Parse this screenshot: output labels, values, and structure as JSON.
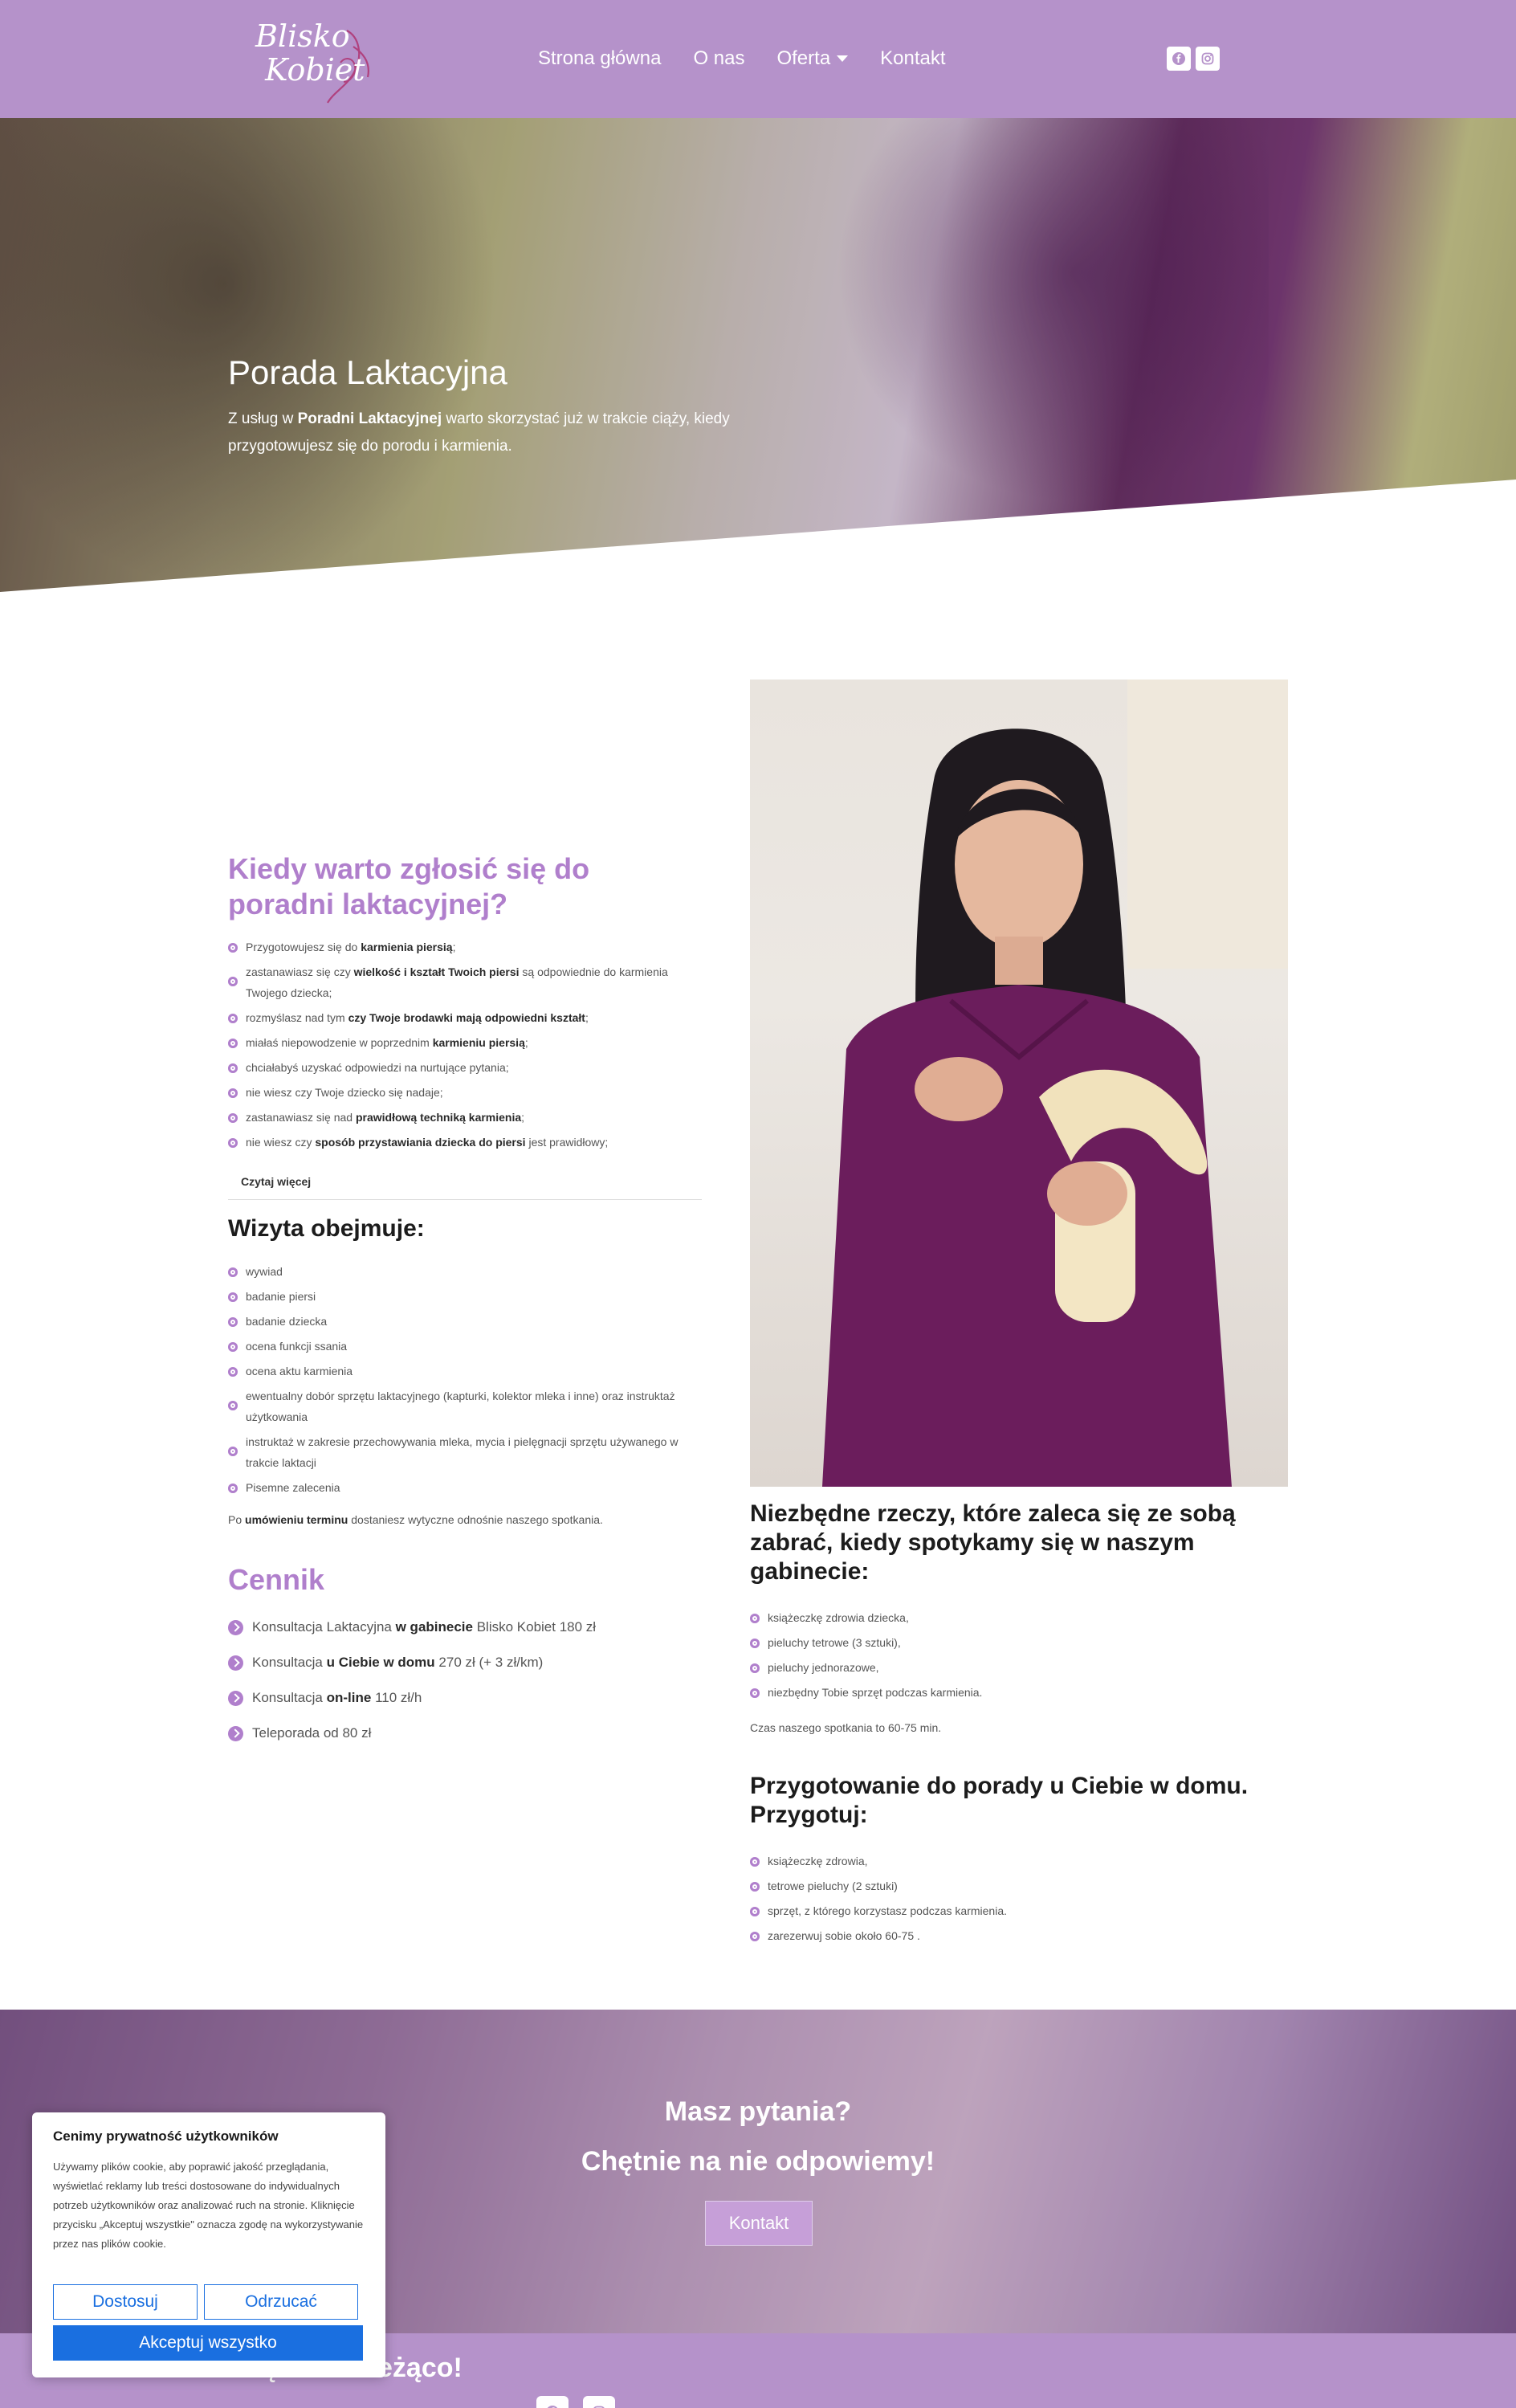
{
  "header": {
    "logo_text": "Blisko\n Kobiet",
    "nav": [
      "Strona główna",
      "O nas",
      "Oferta",
      "Kontakt"
    ]
  },
  "hero": {
    "title": "Porada Laktacyjna",
    "text_before": "Z usług w ",
    "text_bold": "Poradni Laktacyjnej",
    "text_after": " warto skorzystać już w trakcie ciąży, kiedy przygotowujesz się do porodu i karmienia."
  },
  "when": {
    "heading": "Kiedy warto zgłosić się do poradni laktacyjnej?",
    "items": [
      {
        "pre": "Przygotowujesz się do ",
        "bold": "karmienia piersią",
        "post": ";"
      },
      {
        "pre": "zastanawiasz się czy ",
        "bold": "wielkość i kształt Twoich piersi",
        "post": " są odpowiednie do karmienia Twojego dziecka;"
      },
      {
        "pre": "rozmyślasz nad tym ",
        "bold": "czy Twoje brodawki mają odpowiedni kształt",
        "post": ";"
      },
      {
        "pre": "miałaś niepowodzenie w poprzednim ",
        "bold": "karmieniu piersią",
        "post": ";"
      },
      {
        "pre": "chciałabyś uzyskać odpowiedzi na nurtujące pytania;",
        "bold": "",
        "post": ""
      },
      {
        "pre": "nie wiesz czy Twoje dziecko się nadaje;",
        "bold": "",
        "post": ""
      },
      {
        "pre": "zastanawiasz się nad ",
        "bold": "prawidłową techniką karmienia",
        "post": ";"
      },
      {
        "pre": "nie wiesz czy ",
        "bold": "sposób przystawiania dziecka do piersi",
        "post": " jest prawidłowy;"
      }
    ],
    "read_more": "Czytaj więcej"
  },
  "visit": {
    "heading": "Wizyta obejmuje:",
    "items": [
      "wywiad",
      "badanie piersi",
      "badanie dziecka",
      "ocena funkcji ssania",
      "ocena aktu karmienia",
      "ewentualny dobór sprzętu laktacyjnego (kapturki, kolektor mleka i inne) oraz instruktaż użytkowania",
      "instruktaż w zakresie przechowywania mleka, mycia i pielęgnacji sprzętu używanego w trakcie laktacji",
      "Pisemne zalecenia"
    ],
    "note_pre": "Po ",
    "note_bold": "umówieniu terminu",
    "note_post": " dostaniesz wytyczne odnośnie naszego spotkania."
  },
  "pricing": {
    "heading": "Cennik",
    "items": [
      {
        "pre": "Konsultacja Laktacyjna ",
        "bold": "w gabinecie",
        "post": " Blisko Kobiet 180 zł"
      },
      {
        "pre": "Konsultacja ",
        "bold": "u Ciebie w domu",
        "post": " 270 zł (+ 3 zł/km)"
      },
      {
        "pre": "Konsultacja ",
        "bold": "on-line",
        "post": " 110 zł/h"
      },
      {
        "pre": "Teleporada od 80 zł",
        "bold": "",
        "post": ""
      }
    ]
  },
  "bring": {
    "heading": "Niezbędne rzeczy, które zaleca się ze sobą zabrać, kiedy spotykamy się w naszym gabinecie:",
    "items": [
      "książeczkę zdrowia dziecka,",
      "pieluchy tetrowe (3 sztuki),",
      "pieluchy jednorazowe,",
      "niezbędny Tobie sprzęt podczas karmienia."
    ],
    "note": "Czas naszego spotkania to 60-75 min."
  },
  "home": {
    "heading": "Przygotowanie do porady u Ciebie w domu. Przygotuj:",
    "items": [
      "książeczkę zdrowia,",
      "tetrowe pieluchy (2 sztuki)",
      "sprzęt, z którego korzystasz podczas karmienia.",
      "zarezerwuj sobie około 60-75 ."
    ]
  },
  "cta": {
    "title": "Masz pytania?",
    "subtitle": "Chętnie na nie odpowiemy!",
    "button": "Kontakt"
  },
  "footer": {
    "title": "Bądź na bieżąco!"
  },
  "cookie": {
    "title": "Cenimy prywatność użytkowników",
    "text": "Używamy plików cookie, aby poprawić jakość przeglądania, wyświetlać reklamy lub treści dostosowane do indywidualnych potrzeb użytkowników oraz analizować ruch na stronie. Kliknięcie przycisku „Akceptuj wszystkie\" oznacza zgodę na wykorzystywanie przez nas plików cookie.",
    "customize": "Dostosuj",
    "reject": "Odrzucać",
    "accept": "Akceptuj wszystko"
  },
  "colors": {
    "brand_purple": "#b592ca",
    "heading_purple": "#b07fcc",
    "cookie_blue": "#1a6fe0"
  },
  "icons": [
    "facebook-icon",
    "instagram-icon",
    "chevron-down-icon"
  ]
}
